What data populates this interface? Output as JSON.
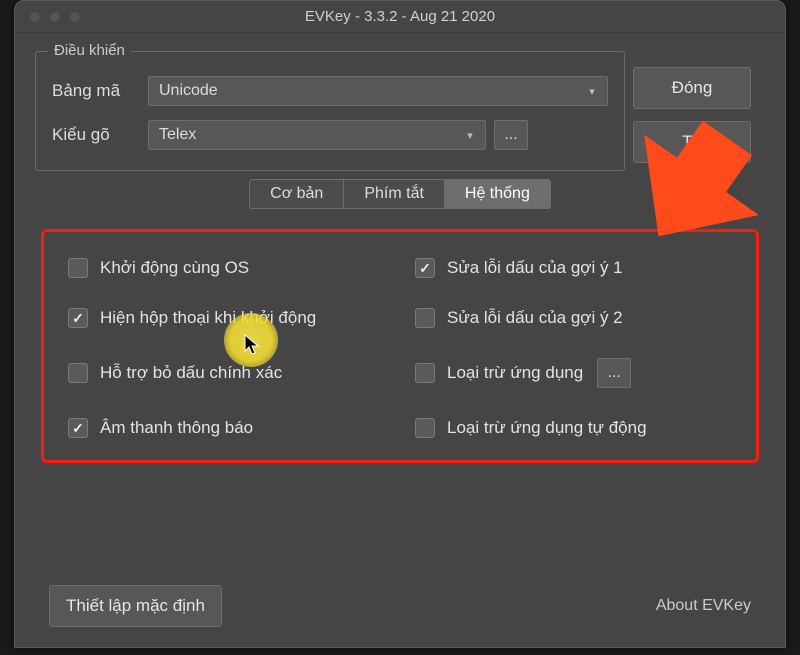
{
  "window": {
    "title": "EVKey - 3.3.2 - Aug 21 2020"
  },
  "group": {
    "legend": "Điều khiển"
  },
  "row_encoding": {
    "label": "Bảng mã",
    "value": "Unicode"
  },
  "row_input": {
    "label": "Kiểu gõ",
    "value": "Telex"
  },
  "buttons": {
    "close": "Đóng",
    "more": "Th",
    "ellipsis": "...",
    "defaults": "Thiết lập mặc định"
  },
  "tabs": {
    "basic": "Cơ bản",
    "shortcuts": "Phím tắt",
    "system": "Hệ thống"
  },
  "checks": {
    "start_os": {
      "label": "Khởi động cùng OS",
      "checked": false
    },
    "fix_hint1": {
      "label": "Sửa lỗi dấu của gợi ý 1",
      "checked": true
    },
    "show_dialog": {
      "label": "Hiện hộp thoại khi khởi động",
      "checked": true
    },
    "fix_hint2": {
      "label": "Sửa lỗi dấu của gợi ý 2",
      "checked": false
    },
    "accurate_mark": {
      "label": "Hỗ trợ bỏ dấu chính xác",
      "checked": false
    },
    "exclude_app": {
      "label": "Loại trừ ứng dụng",
      "checked": false
    },
    "sound_notify": {
      "label": "Âm thanh thông báo",
      "checked": true
    },
    "exclude_auto": {
      "label": "Loại trừ ứng dụng tự động",
      "checked": false
    }
  },
  "about": "About EVKey"
}
